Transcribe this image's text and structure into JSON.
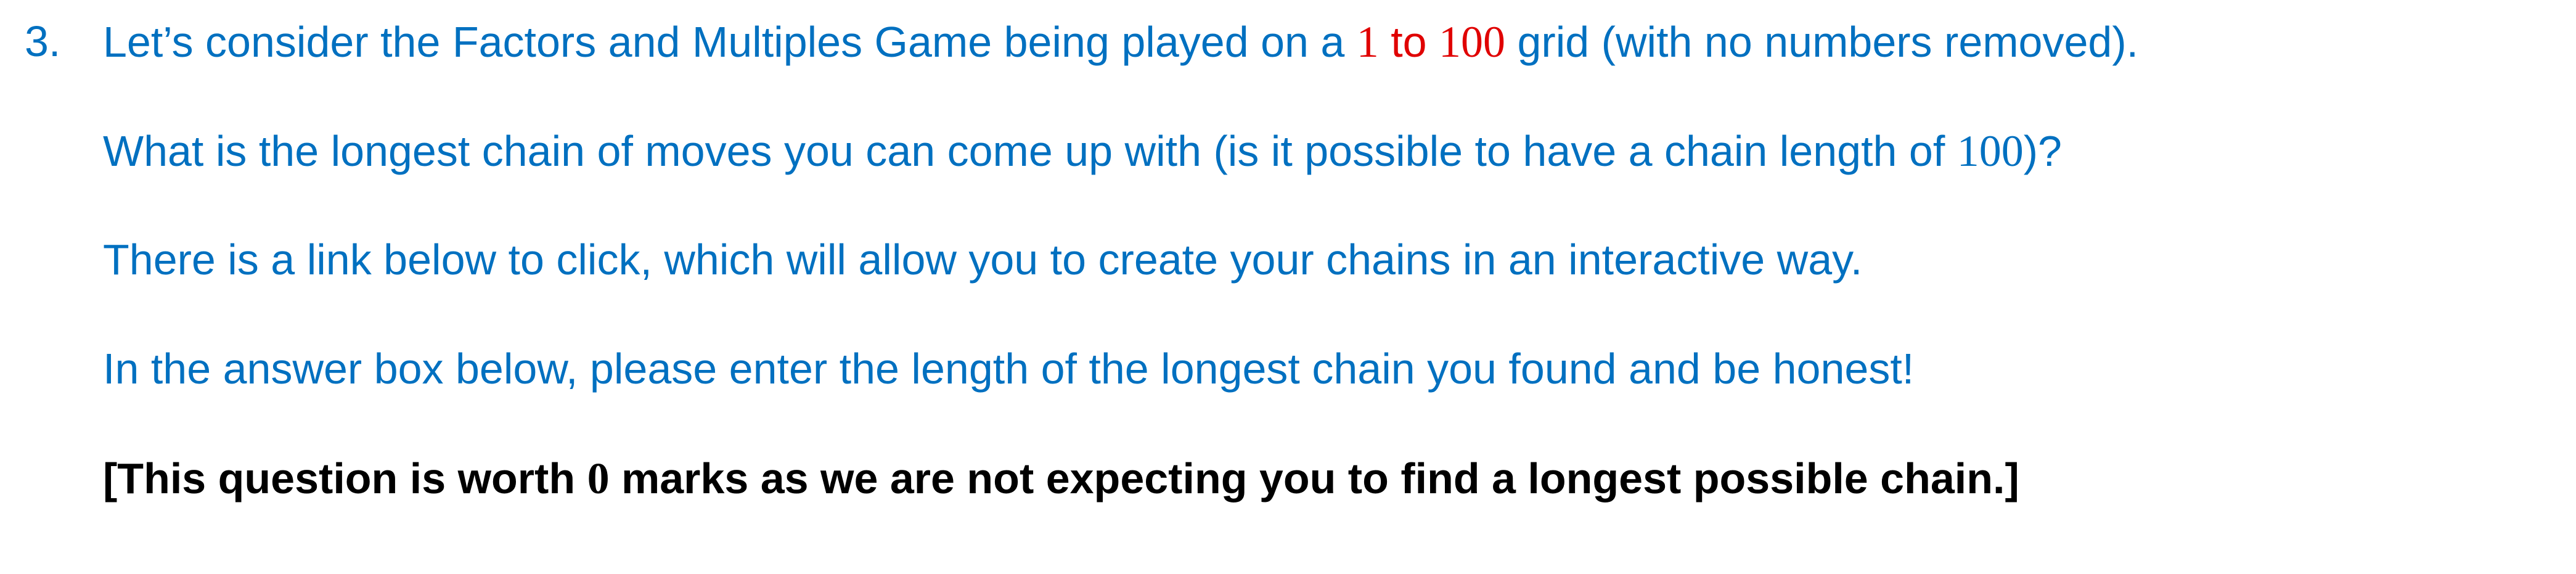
{
  "question": {
    "number": "3.",
    "intro_pre": "Let’s consider the Factors and Multiples Game being played on a ",
    "intro_range_start": "1",
    "intro_range_to": " to ",
    "intro_range_end": "100",
    "intro_post": " grid (with no numbers removed).",
    "chain_pre": "What is the longest chain of moves you can come up with (is it possible to have a chain length of ",
    "chain_num": "100",
    "chain_post": ")?",
    "link_text": "There is a link below to click, which will allow you to create your chains in an interactive way.",
    "answer_text": "In the answer box below, please enter the length of the longest chain you found and be honest!",
    "marks_pre": "[This question is worth ",
    "marks_num": "0",
    "marks_post": " marks as we are not expecting you to find a longest possible chain.]"
  },
  "colors": {
    "body_text": "#0070c0",
    "highlight": "#e00000",
    "emphasis": "#000000"
  }
}
